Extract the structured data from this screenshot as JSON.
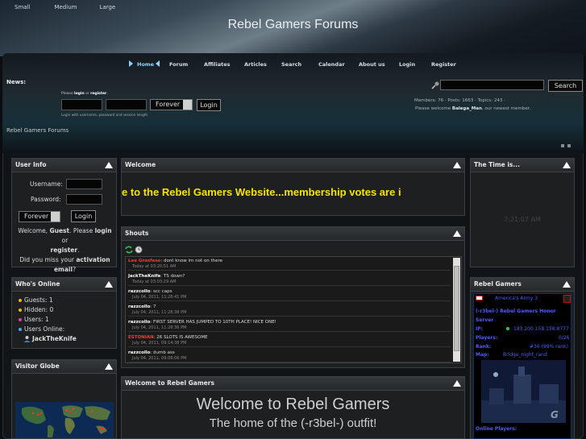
{
  "text_size": {
    "small": "Small",
    "medium": "Medium",
    "large": "Large"
  },
  "site_title": "Rebel Gamers Forums",
  "nav": [
    "Home",
    "Forum",
    "Affiliates",
    "Articles",
    "Search",
    "Calendar",
    "About us",
    "Login",
    "Register"
  ],
  "news_label": "News:",
  "login": {
    "hint_prefix": "Please ",
    "hint_login": "login",
    "hint_or": " or ",
    "hint_register": "register",
    "hint_end": ".",
    "note": "Login with username, password and session length",
    "duration": "Forever",
    "button": "Login"
  },
  "search": {
    "button": "Search"
  },
  "stats": {
    "line1": "Members: 76  ·  Posts: 1663  ·  Topics: 243  ·",
    "welcome_prefix": "Please welcome ",
    "newest": "Balega_Man",
    "welcome_suffix": ", our newest member."
  },
  "breadcrumb": "Rebel Gamers Forums",
  "user_info": {
    "title": "User Info",
    "username_label": "Username:",
    "password_label": "Password:",
    "duration": "Forever",
    "login_button": "Login",
    "welcome_line1": "Welcome, ",
    "guest": "Guest",
    "please": ". Please ",
    "login_link": "login",
    "or": " or",
    "register_link": "register",
    "period": ".",
    "miss_activation": "Did you miss your ",
    "activation": "activation",
    "email": "email",
    "q": "?"
  },
  "whos_online": {
    "title": "Who's Online",
    "guests": "Guests: 1",
    "hidden": "Hidden: 0",
    "users": "Users: 1",
    "users_online": "Users Online:",
    "member": "JackTheKnife"
  },
  "visitor_globe": {
    "title": "Visitor Globe"
  },
  "welcome_panel": {
    "title": "Welcome",
    "marquee": "e to the Rebel Gamers Website...membership votes are i"
  },
  "shouts": {
    "title": "Shouts",
    "items": [
      {
        "name": "Lee Grosfeso",
        "name_color": "#ff3b2f",
        "text": "dont know im not on there",
        "time": "Today at 03:20:51 AM"
      },
      {
        "name": "JackTheKnife",
        "name_color": "#ffffff",
        "text": "TS down?",
        "time": "Today at 03:03:29 AM"
      },
      {
        "name": "razzcollo",
        "name_color": "#ffffff",
        "text": "scc caps",
        "time": "July 04, 2011, 11:28:41 PM"
      },
      {
        "name": "razzcollo",
        "name_color": "#ffffff",
        "text": "7",
        "time": "July 04, 2011, 11:28:38 PM"
      },
      {
        "name": "razzcollo",
        "name_color": "#ffffff",
        "text": "FIRST SERVER HAS JUMPED TO 10TH PLACE! NICE ONE!",
        "time": "July 04, 2011, 11:28:36 PM"
      },
      {
        "name": "ESTONIAN",
        "name_color": "#ff3b2f",
        "text": "26 SLOTS IS AWESOME",
        "time": "July 04, 2011, 09:14:38 PM"
      },
      {
        "name": "razzcollo",
        "name_color": "#ffffff",
        "text": "dumb ass",
        "time": "July 04, 2011, 09:08:06 PM"
      }
    ]
  },
  "welcome_rg": {
    "title": "Welcome to Rebel Gamers",
    "heading": "Welcome to Rebel Gamers",
    "subheading": "The home of the (-r3bel-) outfit!"
  },
  "time_panel": {
    "title": "The Time is...",
    "clock": "7:21:07 AM"
  },
  "rebel_gamers_panel": {
    "title": "Rebel Gamers",
    "game": "America's Army 3",
    "server_name": "(-r3bel-) Rebel Gamers Honor Server",
    "ip_label": "IP:",
    "ip": "183.200.158.158:8777",
    "players_label": "Players:",
    "players": "0/26",
    "rank_label": "Rank:",
    "rank": "#36 (99% rank)",
    "map_label": "Map:",
    "map": "Bridge_night_rand",
    "online_label": "Online Players:"
  },
  "colors": {
    "accent_blue": "#8fd4ff",
    "marquee_yellow": "#f6e400",
    "link_blue": "#4d5cff",
    "red_name": "#ff3b2f"
  }
}
